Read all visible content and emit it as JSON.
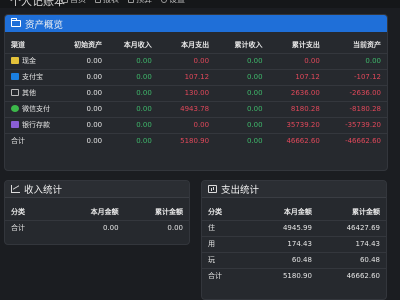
{
  "app": {
    "title": "个人记账本"
  },
  "nav": [
    {
      "label": "首页",
      "icon": "home-icon"
    },
    {
      "label": "报表",
      "icon": "chart-icon"
    },
    {
      "label": "预算",
      "icon": "budget-icon"
    },
    {
      "label": "设置",
      "icon": "gear-icon"
    }
  ],
  "overview": {
    "title": "资产概览",
    "headers": [
      "渠道",
      "初始资产",
      "本月收入",
      "本月支出",
      "累计收入",
      "累计支出",
      "当前资产"
    ],
    "rows": [
      {
        "channel": "现金",
        "icon": "cash-icon",
        "cells": [
          "0.00",
          "0.00",
          "0.00",
          "0.00",
          "0.00",
          "0.00"
        ]
      },
      {
        "channel": "支付宝",
        "icon": "alipay-icon",
        "cells": [
          "0.00",
          "0.00",
          "107.12",
          "0.00",
          "107.12",
          "-107.12"
        ]
      },
      {
        "channel": "其他",
        "icon": "other-icon",
        "cells": [
          "0.00",
          "0.00",
          "130.00",
          "0.00",
          "2636.00",
          "-2636.00"
        ]
      },
      {
        "channel": "微信支付",
        "icon": "wechat-icon",
        "cells": [
          "0.00",
          "0.00",
          "4943.78",
          "0.00",
          "8180.28",
          "-8180.28"
        ]
      },
      {
        "channel": "银行存款",
        "icon": "bank-icon",
        "cells": [
          "0.00",
          "0.00",
          "0.00",
          "0.00",
          "35739.20",
          "-35739.20"
        ]
      },
      {
        "channel": "合计",
        "icon": "",
        "cells": [
          "0.00",
          "0.00",
          "5180.90",
          "0.00",
          "46662.60",
          "-46662.60"
        ]
      }
    ]
  },
  "income": {
    "title": "收入统计",
    "headers": [
      "分类",
      "本月金额",
      "累计金额"
    ],
    "rows": [
      {
        "cells": [
          "合计",
          "0.00",
          "0.00"
        ]
      }
    ]
  },
  "expense": {
    "title": "支出统计",
    "headers": [
      "分类",
      "本月金额",
      "累计金额"
    ],
    "rows": [
      {
        "cells": [
          "住",
          "4945.99",
          "46427.69"
        ]
      },
      {
        "cells": [
          "用",
          "174.43",
          "174.43"
        ]
      },
      {
        "cells": [
          "玩",
          "60.48",
          "60.48"
        ]
      },
      {
        "cells": [
          "合计",
          "5180.90",
          "46662.60"
        ]
      }
    ]
  },
  "colors": {
    "accent": "#1f6fd8",
    "income": "#3fb86b",
    "expense": "#e0485a",
    "background": "#1b1d21",
    "card": "#26292e"
  }
}
